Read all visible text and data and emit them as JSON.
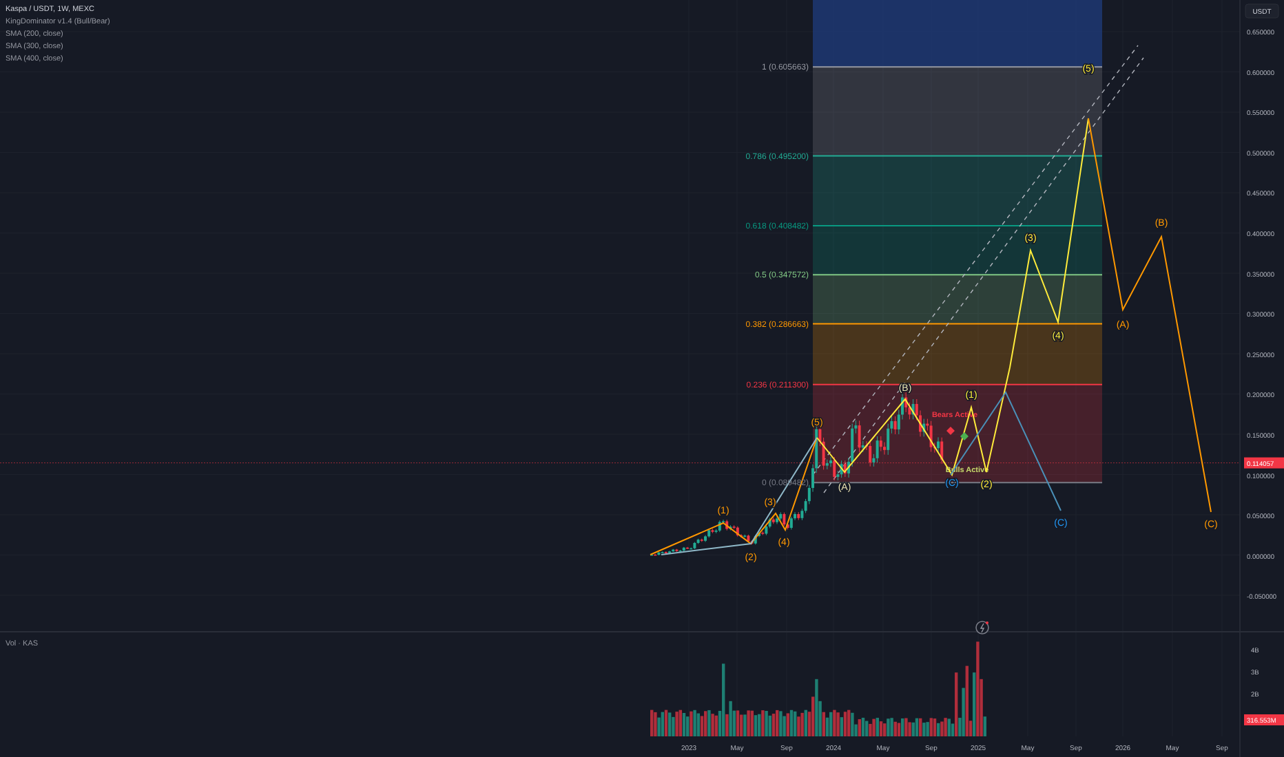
{
  "legend": {
    "title": "Kaspa / USDT, 1W, MEXC",
    "indicators": [
      "KingDominator v1.4 (Bull/Bear)",
      "SMA (200, close)",
      "SMA (300, close)",
      "SMA (400, close)"
    ]
  },
  "price_axis": {
    "currency": "USDT",
    "ticks": [
      "0.650000",
      "0.600000",
      "0.550000",
      "0.500000",
      "0.450000",
      "0.400000",
      "0.350000",
      "0.300000",
      "0.250000",
      "0.200000",
      "0.150000",
      "0.100000",
      "0.050000",
      "0.000000",
      "-0.050000"
    ],
    "last_price": "0.114057"
  },
  "fib_levels": [
    {
      "label": "1 (0.605663)",
      "color": "#9598a1"
    },
    {
      "label": "0.786 (0.495200)",
      "color": "#22ab94"
    },
    {
      "label": "0.618 (0.408482)",
      "color": "#089981"
    },
    {
      "label": "0.5 (0.347572)",
      "color": "#81c784"
    },
    {
      "label": "0.382 (0.286663)",
      "color": "#ff9800"
    },
    {
      "label": "0.236 (0.211300)",
      "color": "#f23645"
    },
    {
      "label": "0 (0.089482)",
      "color": "#787b86"
    }
  ],
  "wave_labels": [
    {
      "text": "(1)",
      "color": "#ff9800"
    },
    {
      "text": "(2)",
      "color": "#ff9800"
    },
    {
      "text": "(3)",
      "color": "#ff9800"
    },
    {
      "text": "(4)",
      "color": "#ff9800"
    },
    {
      "text": "(5)",
      "color": "#ff9800"
    },
    {
      "text": "(A)",
      "color": "#e8e0b0"
    },
    {
      "text": "(B)",
      "color": "#e8e0b0"
    },
    {
      "text": "(C)",
      "color": "#2196f3"
    },
    {
      "text": "(1)",
      "color": "#ffeb3b"
    },
    {
      "text": "(2)",
      "color": "#ffeb3b"
    },
    {
      "text": "(3)",
      "color": "#ffeb3b"
    },
    {
      "text": "(4)",
      "color": "#ffeb3b"
    },
    {
      "text": "(5)",
      "color": "#ffeb3b"
    },
    {
      "text": "(A)",
      "color": "#ff9800"
    },
    {
      "text": "(B)",
      "color": "#ff9800"
    },
    {
      "text": "(C)",
      "color": "#2196f3"
    },
    {
      "text": "(C)",
      "color": "#ff9800"
    }
  ],
  "signals": [
    {
      "text": "Bears Active",
      "color": "#f23645"
    },
    {
      "text": "Bulls Active",
      "color": "#c6d96b"
    }
  ],
  "volume": {
    "title": "Vol · KAS",
    "ticks": [
      "4B",
      "3B",
      "2B"
    ],
    "last_volume": "316.553M"
  },
  "time_axis": [
    "2023",
    "May",
    "Sep",
    "2024",
    "May",
    "Sep",
    "2025",
    "May",
    "Sep",
    "2026",
    "May",
    "Sep"
  ]
}
